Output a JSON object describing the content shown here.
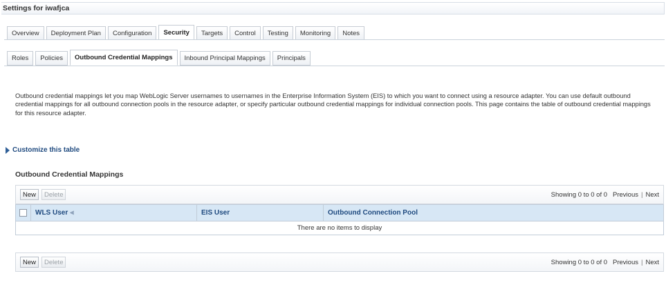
{
  "header": {
    "title": "Settings for iwafjca"
  },
  "main_tabs": [
    {
      "label": "Overview",
      "active": false
    },
    {
      "label": "Deployment Plan",
      "active": false
    },
    {
      "label": "Configuration",
      "active": false
    },
    {
      "label": "Security",
      "active": true
    },
    {
      "label": "Targets",
      "active": false
    },
    {
      "label": "Control",
      "active": false
    },
    {
      "label": "Testing",
      "active": false
    },
    {
      "label": "Monitoring",
      "active": false
    },
    {
      "label": "Notes",
      "active": false
    }
  ],
  "sub_tabs": [
    {
      "label": "Roles",
      "active": false
    },
    {
      "label": "Policies",
      "active": false
    },
    {
      "label": "Outbound Credential Mappings",
      "active": true
    },
    {
      "label": "Inbound Principal Mappings",
      "active": false
    },
    {
      "label": "Principals",
      "active": false
    }
  ],
  "description": "Outbound credential mappings let you map WebLogic Server usernames to usernames in the Enterprise Information System (EIS) to which you want to connect using a resource adapter. You can use default outbound credential mappings for all outbound connection pools in the resource adapter, or specify particular outbound credential mappings for individual connection pools. This page contains the table of outbound credential mappings for this resource adapter.",
  "customize_link": "Customize this table",
  "table": {
    "title": "Outbound Credential Mappings",
    "new_label": "New",
    "delete_label": "Delete",
    "paging_text": "Showing 0 to 0 of 0",
    "previous_label": "Previous",
    "next_label": "Next",
    "columns": [
      "WLS User",
      "EIS User",
      "Outbound Connection Pool"
    ],
    "empty_message": "There are no items to display"
  },
  "colors": {
    "header_bg": "#d7e7f5",
    "link": "#1f4a7f"
  },
  "icons": {
    "sort": "sort-ascending-icon",
    "expand": "expand-triangle-icon"
  }
}
